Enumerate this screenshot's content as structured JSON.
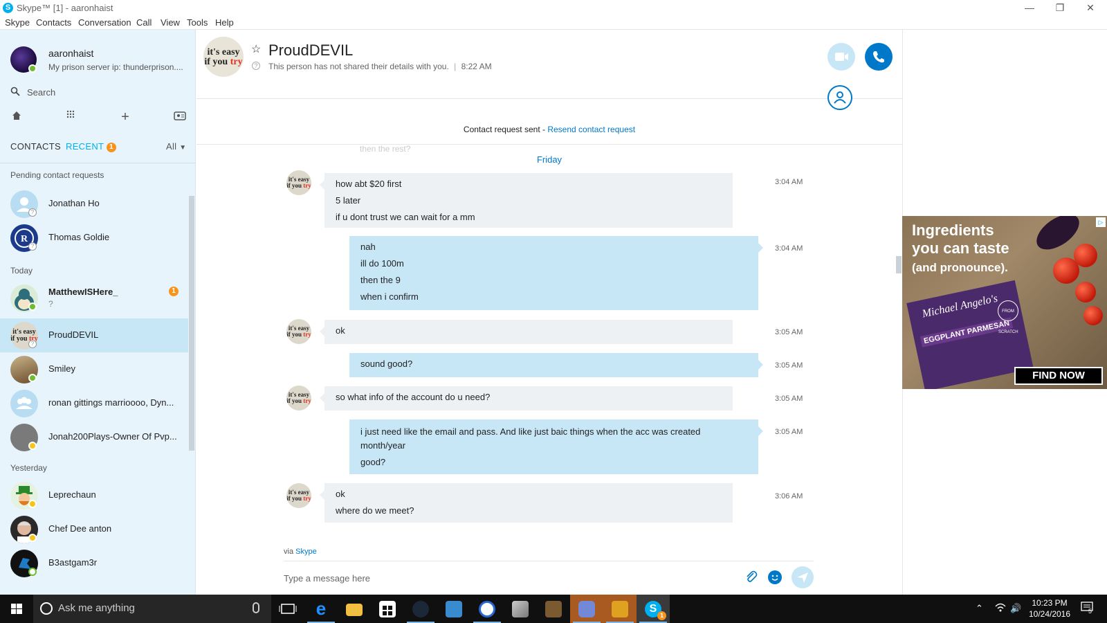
{
  "window": {
    "title": "Skype™ [1] - aaronhaist",
    "controls": [
      "minimize-icon",
      "restore-icon",
      "close-icon"
    ]
  },
  "menu": [
    "Skype",
    "Contacts",
    "Conversation",
    "Call",
    "View",
    "Tools",
    "Help"
  ],
  "profile": {
    "name": "aaronhaist",
    "mood": "My prison server ip: thunderprison....",
    "status": "online"
  },
  "search": {
    "placeholder": "Search"
  },
  "tabs": {
    "contacts": "CONTACTS",
    "recent": "RECENT",
    "recent_badge": "1",
    "filter": "All"
  },
  "sections": {
    "pending": "Pending contact requests",
    "today": "Today",
    "yesterday": "Yesterday"
  },
  "contacts": [
    {
      "name": "Jonathan Ho",
      "status": "unknown"
    },
    {
      "name": "Thomas Goldie",
      "status": "unknown"
    },
    {
      "name": "MatthewISHere_",
      "sub": "?",
      "badge": "1",
      "status": "online"
    },
    {
      "name": "ProudDEVIL",
      "status": "unknown",
      "selected": true
    },
    {
      "name": "Smiley",
      "status": "online"
    },
    {
      "name": "ronan gittings marrioooo, Dyn...",
      "status": "none"
    },
    {
      "name": "Jonah200Plays-Owner Of Pvp...",
      "status": "away"
    },
    {
      "name": "Leprechaun",
      "status": "away"
    },
    {
      "name": "Chef Dee anton",
      "status": "away"
    },
    {
      "name": "B3astgam3r",
      "status": "online"
    }
  ],
  "conversation": {
    "name": "ProudDEVIL",
    "info": "This person has not shared their details with you.",
    "time": "8:22 AM",
    "avatar_text_1": "it's easy",
    "avatar_text_2": "if you ",
    "avatar_text_3": "try",
    "request_text": "Contact request sent - ",
    "request_link": "Resend contact request",
    "faded_text": "then the rest?",
    "day": "Friday",
    "messages": [
      {
        "dir": "in",
        "time": "3:04 AM",
        "lines": [
          "how abt $20 first",
          "5 later",
          "if u dont trust we can wait for a mm"
        ]
      },
      {
        "dir": "out",
        "time": "3:04 AM",
        "lines": [
          "nah",
          "ill do 100m",
          "then the 9",
          "when i confirm"
        ]
      },
      {
        "dir": "in",
        "time": "3:05 AM",
        "lines": [
          "ok"
        ]
      },
      {
        "dir": "out",
        "time": "3:05 AM",
        "lines": [
          "sound good?"
        ]
      },
      {
        "dir": "in",
        "time": "3:05 AM",
        "lines": [
          "so what info of the account do u need?"
        ]
      },
      {
        "dir": "out",
        "time": "3:05 AM",
        "lines": [
          "i just need like the email and pass. And like just baic things when the acc was created month/year",
          "good?"
        ]
      },
      {
        "dir": "in",
        "time": "3:06 AM",
        "lines": [
          "ok",
          "where do we meet?"
        ]
      }
    ],
    "via_prefix": "via ",
    "via_link": "Skype",
    "compose_placeholder": "Type a message here"
  },
  "ad": {
    "headline_1": "Ingredients",
    "headline_2": "you can taste",
    "headline_3": "(and pronounce).",
    "brand": "Michael Angelo's",
    "product": "EGGPLANT PARMESAN",
    "seal": "FROM SCRATCH",
    "cta": "FIND NOW",
    "adchoices": "▷"
  },
  "taskbar": {
    "search_text": "Ask me anything",
    "time": "10:23 PM",
    "date": "10/24/2016",
    "notifications": "5",
    "skype_badge": "1",
    "apps": [
      "task-view",
      "edge",
      "file-explorer",
      "store",
      "steam",
      "app-blue",
      "app-g",
      "app-image",
      "minecraft",
      "discord",
      "csgo",
      "skype"
    ]
  },
  "colors": {
    "accent": "#00aff0",
    "link": "#0078ca",
    "outgoing_bubble": "#c7e7f7",
    "incoming_bubble": "#eef1f3",
    "sidebar": "#e8f4fb",
    "badge": "#f7941d"
  }
}
